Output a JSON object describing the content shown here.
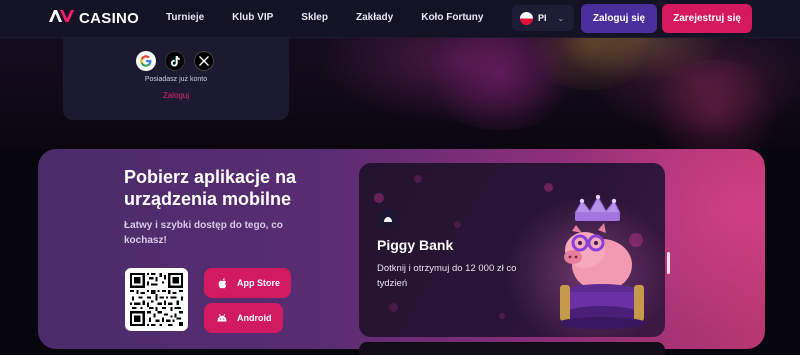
{
  "brand": {
    "logo_mark": "AV",
    "logo_text": "CASINO",
    "accent": "#d6185f",
    "secondary": "#4a2f9c"
  },
  "nav": {
    "items": [
      "Turnieje",
      "Klub VIP",
      "Sklep",
      "Zakłady",
      "Koło Fortuny"
    ],
    "more": "···"
  },
  "language": {
    "code": "Pl",
    "flag": "poland-flag-icon"
  },
  "auth": {
    "login_label": "Zaloguj się",
    "register_label": "Zarejestruj się"
  },
  "login_card": {
    "social_icons": [
      "google-icon",
      "tiktok-icon",
      "x-icon"
    ],
    "have_account": "Posiadasz już konto",
    "login_link": "Zaloguj"
  },
  "app_section": {
    "title": "Pobierz aplikacje na urządzenia mobilne",
    "subtitle": "Łatwy i szybki dostęp do tego, co kochasz!",
    "app_store_label": "App Store",
    "android_label": "Android"
  },
  "promo": {
    "title": "Piggy Bank",
    "description": "Dotknij i otrzymuj do 12 000 zł co tydzień"
  }
}
